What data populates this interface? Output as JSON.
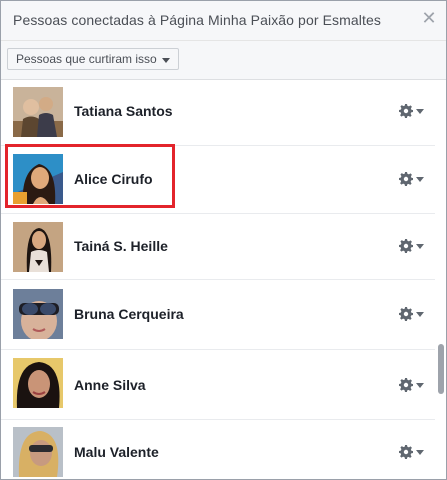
{
  "dialog": {
    "title": "Pessoas conectadas à Página Minha Paixão por Esmaltes",
    "close_icon": "close-icon"
  },
  "filter": {
    "label": "Pessoas que curtiram isso"
  },
  "people": [
    {
      "name": "Tatiana Santos",
      "colors": [
        "#b89d7a",
        "#5c4630",
        "#c9b39a"
      ]
    },
    {
      "name": "Alice Cirufo",
      "colors": [
        "#3a5a8c",
        "#2b1a12",
        "#e0a97a"
      ]
    },
    {
      "name": "Tainá S. Heille",
      "colors": [
        "#c4a482",
        "#1d1410",
        "#e9e0d8"
      ]
    },
    {
      "name": "Bruna Cerqueira",
      "colors": [
        "#6d7f9a",
        "#d8b29a",
        "#1d1d24"
      ]
    },
    {
      "name": "Anne Silva",
      "colors": [
        "#e7c86a",
        "#1a1210",
        "#c99477"
      ]
    },
    {
      "name": "Malu Valente",
      "colors": [
        "#b9c0c8",
        "#d8b064",
        "#c79a80"
      ]
    }
  ],
  "highlight_color": "#e3242b"
}
